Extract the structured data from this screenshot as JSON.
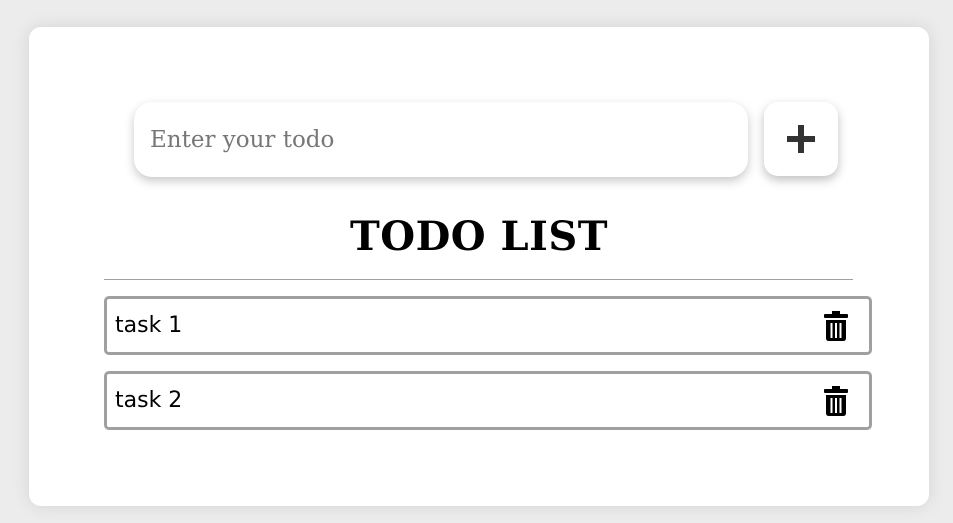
{
  "input": {
    "placeholder": "Enter your todo",
    "value": ""
  },
  "add_button": {
    "icon": "plus-icon"
  },
  "title": "TODO LIST",
  "tasks": [
    {
      "label": "task 1",
      "delete_icon": "trash-icon"
    },
    {
      "label": "task 2",
      "delete_icon": "trash-icon"
    }
  ],
  "colors": {
    "page_background": "#ececec",
    "card_background": "#ffffff",
    "task_border": "#a0a0a0",
    "plus_icon": "#333333",
    "trash_icon": "#000000"
  }
}
